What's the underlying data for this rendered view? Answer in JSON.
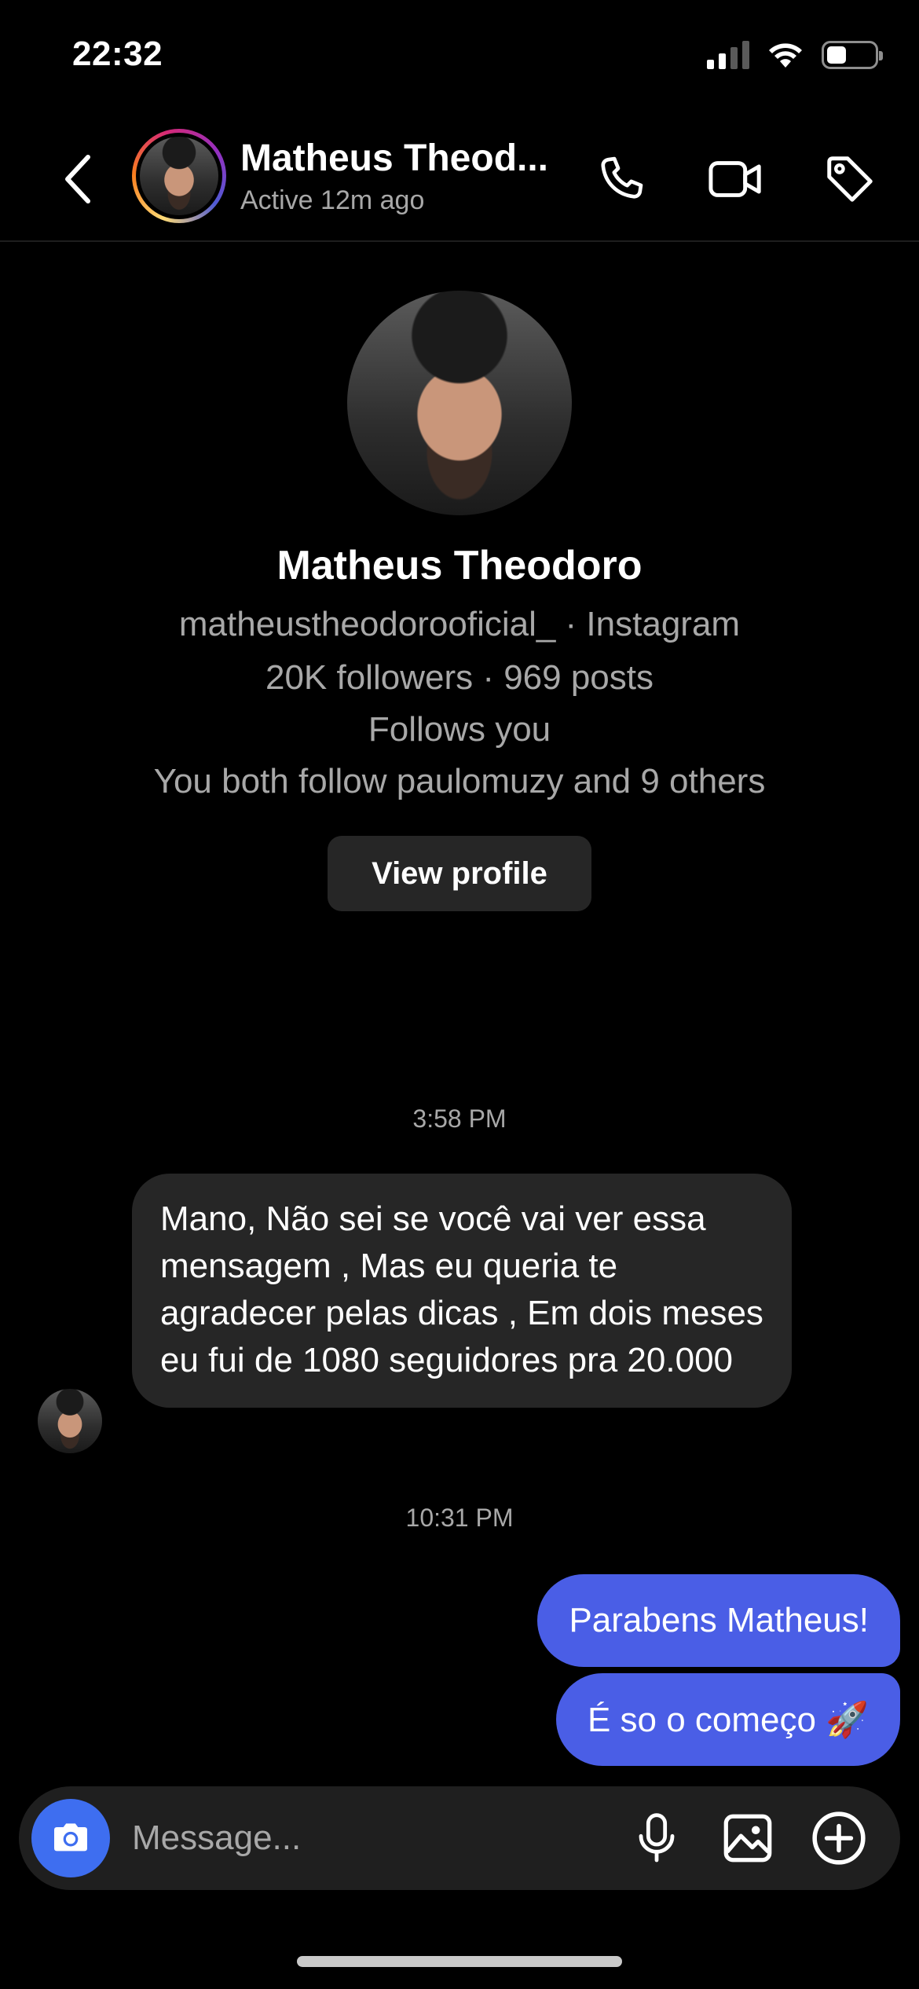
{
  "status_bar": {
    "time": "22:32",
    "battery_level": 0.3,
    "signal_bars_active": 2
  },
  "header": {
    "name": "Matheus Theod...",
    "status": "Active 12m ago",
    "icons": [
      "back-icon",
      "phone-icon",
      "video-camera-icon",
      "tag-icon"
    ]
  },
  "profile": {
    "name": "Matheus Theodoro",
    "handle_line": "matheustheodorooficial_ · Instagram",
    "stats_line": "20K followers · 969 posts",
    "follows_line": "Follows you",
    "mutual_line": "You both follow paulomuzy and 9 others",
    "view_profile_label": "View profile"
  },
  "messages": [
    {
      "type": "timestamp",
      "text": "3:58 PM"
    },
    {
      "type": "incoming",
      "text": "Mano, Não sei se você vai ver essa mensagem  , Mas eu queria te agradecer pelas dicas  , Em dois meses eu fui de 1080 seguidores pra 20.000"
    },
    {
      "type": "timestamp",
      "text": "10:31 PM"
    },
    {
      "type": "outgoing",
      "text": "Parabens Matheus!"
    },
    {
      "type": "outgoing",
      "text": "É so o começo 🚀"
    }
  ],
  "composer": {
    "placeholder": "Message...",
    "icons": [
      "camera-icon",
      "microphone-icon",
      "image-icon",
      "plus-circle-icon"
    ]
  },
  "colors": {
    "background": "#000000",
    "outgoing_bubble": "#4a5ee6",
    "incoming_bubble": "#262626",
    "camera_button": "#3e6ef0",
    "secondary_text": "#a8a8a8"
  }
}
